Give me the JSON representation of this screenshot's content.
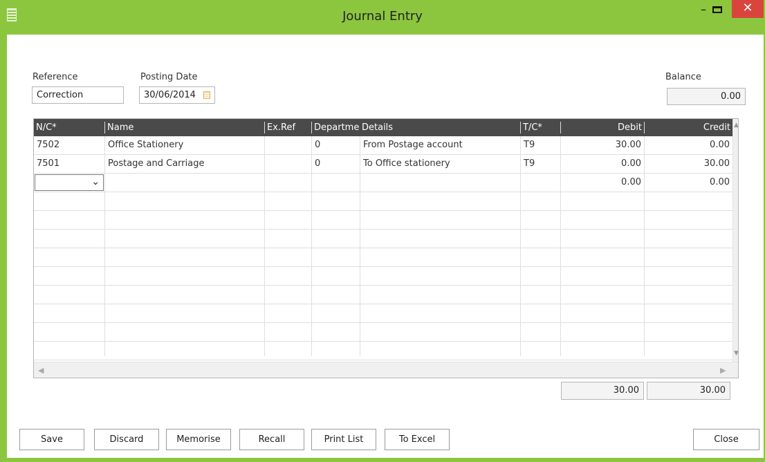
{
  "window": {
    "title": "Journal Entry",
    "minimize_glyph": "–",
    "close_glyph": "✕",
    "icon": "ledger-icon"
  },
  "form": {
    "reference_label": "Reference",
    "reference_value": "Correction",
    "posting_date_label": "Posting Date",
    "posting_date_value": "30/06/2014",
    "balance_label": "Balance",
    "balance_value": "0.00"
  },
  "grid": {
    "columns": [
      "N/C*",
      "Name",
      "Ex.Ref",
      "Departme",
      "Details",
      "T/C*",
      "Debit",
      "Credit"
    ],
    "rows": [
      {
        "nc": "7502",
        "name": "Office Stationery",
        "exref": "",
        "dept": "0",
        "details": "From Postage account",
        "tc": "T9",
        "debit": "30.00",
        "credit": "0.00"
      },
      {
        "nc": "7501",
        "name": "Postage and Carriage",
        "exref": "",
        "dept": "0",
        "details": "To Office stationery",
        "tc": "T9",
        "debit": "0.00",
        "credit": "30.00"
      },
      {
        "nc": "",
        "name": "",
        "exref": "",
        "dept": "",
        "details": "",
        "tc": "",
        "debit": "0.00",
        "credit": "0.00"
      }
    ]
  },
  "totals": {
    "debit": "30.00",
    "credit": "30.00"
  },
  "buttons": {
    "save": "Save",
    "discard": "Discard",
    "memorise": "Memorise",
    "recall": "Recall",
    "print_list": "Print List",
    "to_excel": "To Excel",
    "close": "Close"
  }
}
